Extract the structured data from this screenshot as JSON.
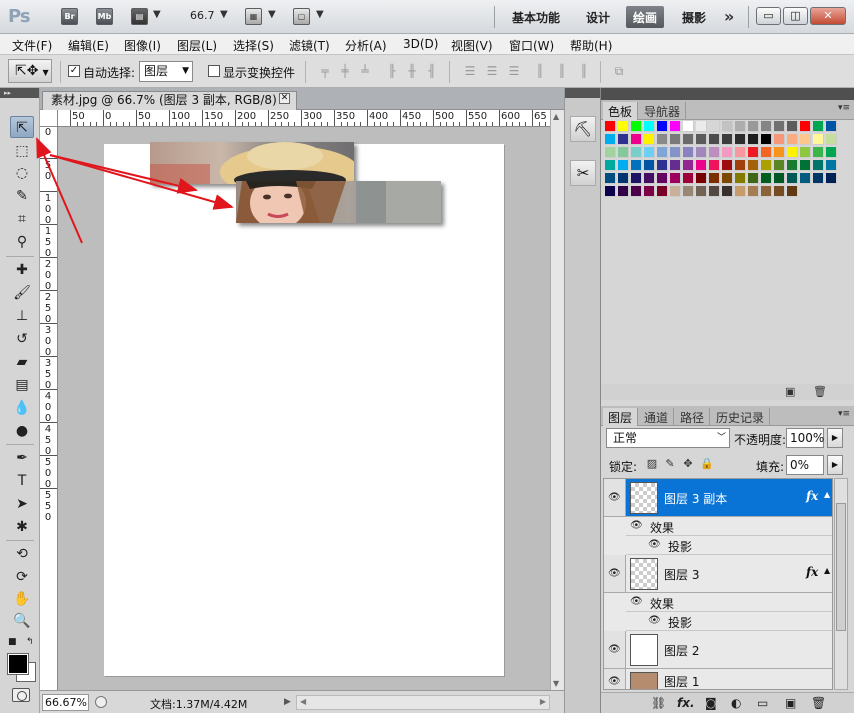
{
  "title_bar": {
    "app_logo": "Ps",
    "bridge_label": "Br",
    "minibridge_label": "Mb",
    "zoom": "66.7",
    "workspaces": [
      "基本功能",
      "设计",
      "绘画",
      "摄影"
    ],
    "active_workspace": "绘画",
    "more_label": "»",
    "window_buttons": [
      "minimize",
      "restore",
      "close"
    ]
  },
  "menu": [
    "文件(F)",
    "编辑(E)",
    "图像(I)",
    "图层(L)",
    "选择(S)",
    "滤镜(T)",
    "分析(A)",
    "3D(D)",
    "视图(V)",
    "窗口(W)",
    "帮助(H)"
  ],
  "options": {
    "tool_icon": "move-tool-icon",
    "auto_select_checked": true,
    "auto_select_label": "自动选择:",
    "auto_select_target": "图层",
    "show_transform_checked": false,
    "show_transform_label": "显示变换控件"
  },
  "document": {
    "tab_title": "素材.jpg @ 66.7% (图层 3 副本, RGB/8) *",
    "ruler_top_labels": [
      "50",
      "0",
      "50",
      "100",
      "150",
      "200",
      "250",
      "300",
      "350",
      "400",
      "450",
      "500",
      "550",
      "600",
      "65"
    ],
    "ruler_left_labels": [
      "0",
      "5\n0",
      "1\n0\n0",
      "1\n5\n0",
      "2\n0\n0",
      "2\n5\n0",
      "3\n0\n0",
      "3\n5\n0",
      "4\n0\n0",
      "4\n5\n0",
      "5\n0\n0",
      "5\n5\n0"
    ],
    "zoom_display": "66.67%",
    "doc_info": "文档:1.37M/4.42M"
  },
  "swatches_panel": {
    "tabs": [
      "色板",
      "导航器"
    ],
    "active_tab": "色板",
    "colors": [
      "#ff0000",
      "#ffff00",
      "#00ff00",
      "#00ffff",
      "#0000ff",
      "#ff00ff",
      "#ffffff",
      "#ebebeb",
      "#d6d6d6",
      "#c2c2c2",
      "#adadad",
      "#999999",
      "#858585",
      "#707070",
      "#5c5c5c",
      "#ff0000",
      "#00a651",
      "#0054a6",
      "#00aeef",
      "#2e3192",
      "#ec008c",
      "#fff200",
      "#898989",
      "#7a7a7a",
      "#6a6a6a",
      "#5b5b5b",
      "#4c4c4c",
      "#3c3c3c",
      "#2d2d2d",
      "#1e1e1e",
      "#000000",
      "#f7977a",
      "#f9ad81",
      "#fdc68a",
      "#fff79a",
      "#c4df9b",
      "#a3d39c",
      "#82ca9d",
      "#7bcdc8",
      "#6ecff6",
      "#7ea7d8",
      "#8493ca",
      "#8882be",
      "#a187be",
      "#bc8dbf",
      "#f49ac2",
      "#f6989d",
      "#ed1c24",
      "#f26522",
      "#f7941d",
      "#fff200",
      "#8dc63f",
      "#39b54a",
      "#00a651",
      "#00a99d",
      "#00aeef",
      "#0072bc",
      "#0054a6",
      "#2e3192",
      "#662d91",
      "#92278f",
      "#ec008c",
      "#ed145b",
      "#9e0b0f",
      "#a0410d",
      "#a36209",
      "#aba000",
      "#598527",
      "#197b30",
      "#007236",
      "#00746b",
      "#0076a3",
      "#004b80",
      "#003471",
      "#1b1464",
      "#440e62",
      "#630460",
      "#9e005d",
      "#9e0039",
      "#790000",
      "#7b2e00",
      "#7d4900",
      "#827b00",
      "#406618",
      "#005e20",
      "#005826",
      "#005952",
      "#005b7f",
      "#003663",
      "#002157",
      "#0d004c",
      "#32004b",
      "#4b0049",
      "#7b0046",
      "#7a0026",
      "#c7b299",
      "#998675",
      "#736357",
      "#534741",
      "#37302d",
      "#c69c6d",
      "#a67c52",
      "#8c6239",
      "#754c24",
      "#603913"
    ]
  },
  "layers_panel": {
    "tabs": [
      "图层",
      "通道",
      "路径",
      "历史记录"
    ],
    "active_tab": "图层",
    "blend_mode": "正常",
    "opacity_label": "不透明度:",
    "opacity": "100%",
    "lock_label": "锁定:",
    "fill_label": "填充:",
    "fill": "0%",
    "layers": [
      {
        "name": "图层 3 副本",
        "selected": true,
        "fx": true
      },
      {
        "name": "图层 3",
        "selected": false,
        "fx": true
      },
      {
        "name": "图层 2",
        "selected": false,
        "fx": false
      },
      {
        "name": "图层 1",
        "selected": false,
        "fx": false
      }
    ],
    "effects_label": "效果",
    "drop_shadow_label": "投影",
    "fx_label": "fx"
  },
  "accent_colors": {
    "selection_blue": "#0a74d6",
    "annotation_red": "#e0161c"
  }
}
